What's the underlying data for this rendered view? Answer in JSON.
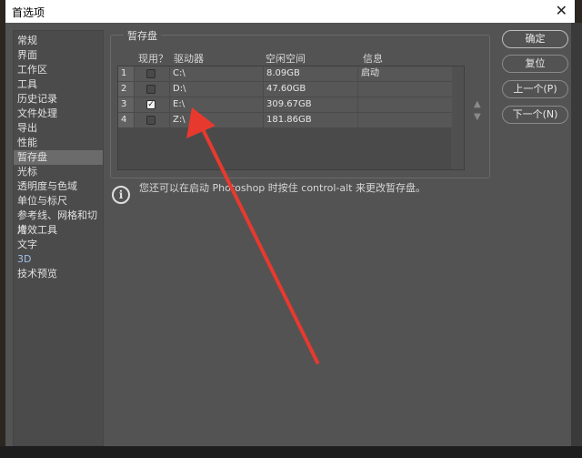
{
  "window": {
    "title": "首选项",
    "close": "✕"
  },
  "sidebar": {
    "items": [
      {
        "label": "常规"
      },
      {
        "label": "界面"
      },
      {
        "label": "工作区"
      },
      {
        "label": "工具"
      },
      {
        "label": "历史记录"
      },
      {
        "label": "文件处理"
      },
      {
        "label": "导出"
      },
      {
        "label": "性能"
      },
      {
        "label": "暂存盘",
        "selected": true
      },
      {
        "label": "光标"
      },
      {
        "label": "透明度与色域"
      },
      {
        "label": "单位与标尺"
      },
      {
        "label": "参考线、网格和切片"
      },
      {
        "label": "增效工具"
      },
      {
        "label": "文字"
      },
      {
        "label": "3D"
      },
      {
        "label": "技术预览"
      }
    ]
  },
  "scratch": {
    "group_label": "暂存盘",
    "headers": {
      "active": "现用？",
      "drive": "驱动器",
      "free": "空闲空间",
      "info": "信息"
    },
    "rows": [
      {
        "num": "1",
        "checked": false,
        "drive": "C:\\",
        "free": "8.09GB",
        "info": "启动"
      },
      {
        "num": "2",
        "checked": false,
        "drive": "D:\\",
        "free": "47.60GB",
        "info": ""
      },
      {
        "num": "3",
        "checked": true,
        "drive": "E:\\",
        "free": "309.67GB",
        "info": ""
      },
      {
        "num": "4",
        "checked": false,
        "drive": "Z:\\",
        "free": "181.86GB",
        "info": ""
      }
    ],
    "move_up": "▲",
    "move_down": "▼",
    "note": "您还可以在启动 Photoshop 时按住 control-alt 来更改暂存盘。"
  },
  "buttons": {
    "ok": "确定",
    "reset": "复位",
    "prev": "上一个(P)",
    "next": "下一个(N)"
  },
  "annotation_color": "#e8392f"
}
